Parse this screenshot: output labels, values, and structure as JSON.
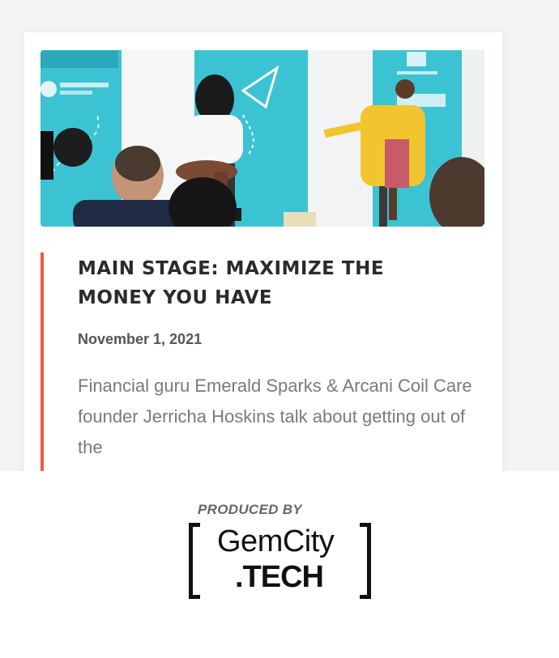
{
  "article": {
    "title": "MAIN STAGE: MAXIMIZE THE MONEY YOU HAVE",
    "date": "November 1, 2021",
    "excerpt": "Financial guru Emerald Sparks & Arcani Coil Care founder Jerricha Hoskins talk about getting out of the",
    "accent_color": "#ef5a3c",
    "image_icon": "stage-photo"
  },
  "footer": {
    "produced_by": "PRODUCED BY",
    "logo_line1": "GemCity",
    "logo_line2": ".TECH"
  },
  "colors": {
    "backdrop": "#3cc3d3",
    "title": "#2b2b2b",
    "date": "#555555",
    "excerpt": "#7a7a7a"
  }
}
